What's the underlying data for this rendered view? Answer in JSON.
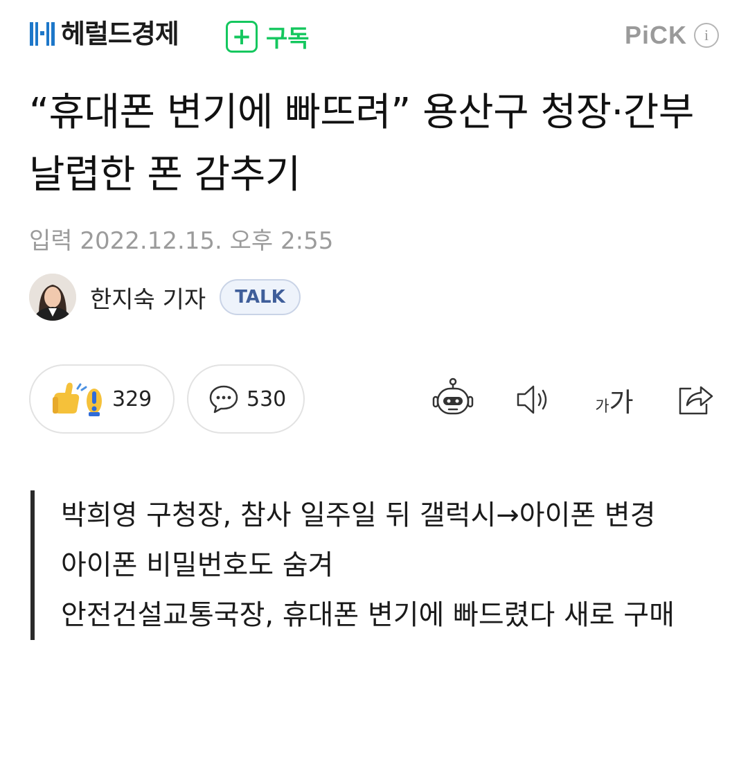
{
  "header": {
    "publisher": "헤럴드경제",
    "subscribe_plus": "+",
    "subscribe_label": "구독",
    "pick_label": "PiCK",
    "info_icon": "i",
    "brand_color": "#14c75e"
  },
  "article": {
    "title": "“휴대폰 변기에 빠뜨려” 용산구 청장·간부 날렵한 폰 감추기",
    "date": "입력 2022.12.15. 오후 2:55",
    "author": "한지숙 기자",
    "talk_label": "TALK"
  },
  "reactions": {
    "reaction_count": "329",
    "comment_count": "530"
  },
  "toolbar": {
    "font_small": "가",
    "font_large": "가"
  },
  "summary": [
    "박희영 구청장, 참사 일주일 뒤 갤럭시→아이폰 변경",
    "아이폰 비밀번호도 숨겨",
    "안전건설교통국장, 휴대폰 변기에 빠드렸다 새로 구매"
  ]
}
